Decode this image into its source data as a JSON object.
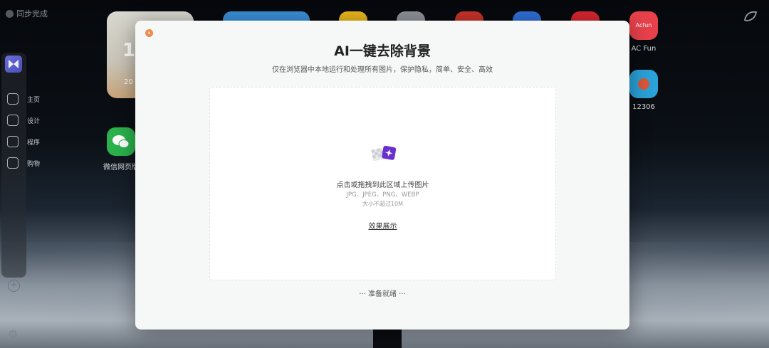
{
  "topbar": {
    "sync_label": "同步完成"
  },
  "dock": {
    "items": [
      {
        "label": "主页",
        "icon": "home-icon"
      },
      {
        "label": "设计",
        "icon": "pen-icon"
      },
      {
        "label": "程序",
        "icon": "program-icon"
      },
      {
        "label": "购物",
        "icon": "bag-icon"
      }
    ]
  },
  "desktop": {
    "apps": [
      {
        "label": "AC Fun",
        "tile_text": "Acfun",
        "color": "#e8414b"
      },
      {
        "label": "12306",
        "color": "#2aa1d8"
      },
      {
        "label": "微信网页版",
        "color": "#2bb24c"
      }
    ],
    "widget_text": "1",
    "widget_sub": "20"
  },
  "modal": {
    "title": "AI一键去除背景",
    "subtitle": "仅在浏览器中本地运行和处理所有图片，保护隐私，简单、安全、高效",
    "dropzone": {
      "main": "点击或拖拽到此区域上传图片",
      "formats": "JPG、JPEG、PNG、WEBP",
      "size": "大小不超过10M",
      "demo": "效果展示"
    },
    "status": "··· 准备就绪 ···"
  },
  "colors": {
    "accent_close": "#f08a4b",
    "icon_purple": "#6a2fd1"
  }
}
